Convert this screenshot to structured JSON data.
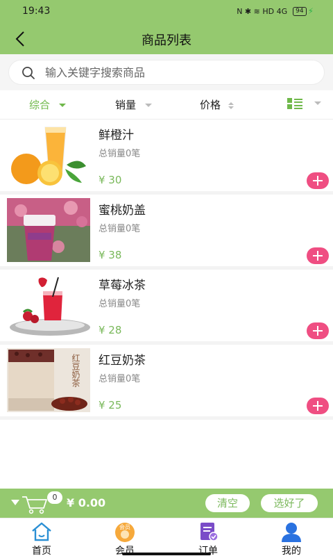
{
  "status": {
    "time": "19:43",
    "icons_text": "N ✱ ≋ HD 4G",
    "battery": "94"
  },
  "nav": {
    "title": "商品列表"
  },
  "search": {
    "placeholder": "输入关键字搜索商品"
  },
  "sort": {
    "items": [
      "综合",
      "销量",
      "价格"
    ]
  },
  "products": [
    {
      "name": "鲜橙汁",
      "sales": "总销量0笔",
      "price": "¥ 30"
    },
    {
      "name": "蜜桃奶盖",
      "sales": "总销量0笔",
      "price": "¥ 38"
    },
    {
      "name": "草莓冰茶",
      "sales": "总销量0笔",
      "price": "¥ 28"
    },
    {
      "name": "红豆奶茶",
      "sales": "总销量0笔",
      "price": "¥ 25"
    }
  ],
  "thumb_text": {
    "member_badge": "会员",
    "red_bean_caption": "红豆奶茶"
  },
  "cart": {
    "count": "0",
    "total": "¥ 0.00",
    "clear_label": "清空",
    "choose_label": "选好了"
  },
  "tabs": [
    {
      "label": "首页",
      "icon": "home-icon"
    },
    {
      "label": "会员",
      "icon": "member-icon"
    },
    {
      "label": "订单",
      "icon": "order-icon"
    },
    {
      "label": "我的",
      "icon": "profile-icon"
    }
  ],
  "colors": {
    "theme_green": "#95c96f",
    "accent_green": "#6fb84a",
    "add_pink": "#ef4e82"
  }
}
